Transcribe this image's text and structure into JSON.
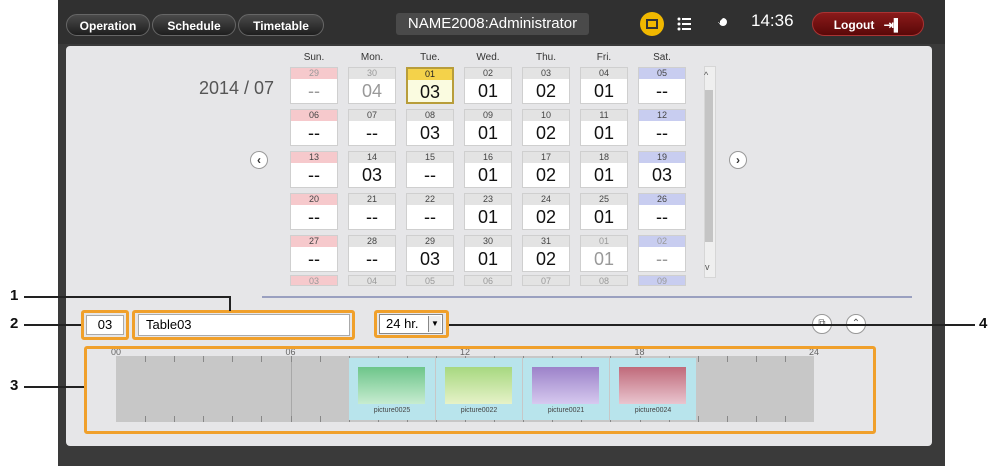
{
  "topbar": {
    "tabs": [
      {
        "label": "Operation"
      },
      {
        "label": "Schedule"
      },
      {
        "label": "Timetable"
      }
    ],
    "user": "NAME2008:Administrator",
    "time": "14:36",
    "logout_label": "Logout",
    "icons": [
      "schedule-folder-icon",
      "list-icon",
      "wrench-icon",
      "logout-icon"
    ],
    "colors": {
      "bar": "#303030",
      "logout": "#7a1212",
      "active_icon": "#f0b800"
    }
  },
  "calendar": {
    "year_month": "2014 / 07",
    "day_headers": [
      "Sun.",
      "Mon.",
      "Tue.",
      "Wed.",
      "Thu.",
      "Fri.",
      "Sat."
    ],
    "weeks": [
      [
        {
          "d": "29",
          "v": "--"
        },
        {
          "d": "30",
          "v": "04"
        },
        {
          "d": "01",
          "v": "03"
        },
        {
          "d": "02",
          "v": "01"
        },
        {
          "d": "03",
          "v": "02"
        },
        {
          "d": "04",
          "v": "01"
        },
        {
          "d": "05",
          "v": "--"
        }
      ],
      [
        {
          "d": "06",
          "v": "--"
        },
        {
          "d": "07",
          "v": "--"
        },
        {
          "d": "08",
          "v": "03"
        },
        {
          "d": "09",
          "v": "01"
        },
        {
          "d": "10",
          "v": "02"
        },
        {
          "d": "11",
          "v": "01"
        },
        {
          "d": "12",
          "v": "--"
        }
      ],
      [
        {
          "d": "13",
          "v": "--"
        },
        {
          "d": "14",
          "v": "03"
        },
        {
          "d": "15",
          "v": "--"
        },
        {
          "d": "16",
          "v": "01"
        },
        {
          "d": "17",
          "v": "02"
        },
        {
          "d": "18",
          "v": "01"
        },
        {
          "d": "19",
          "v": "03"
        }
      ],
      [
        {
          "d": "20",
          "v": "--"
        },
        {
          "d": "21",
          "v": "--"
        },
        {
          "d": "22",
          "v": "--"
        },
        {
          "d": "23",
          "v": "01"
        },
        {
          "d": "24",
          "v": "02"
        },
        {
          "d": "25",
          "v": "01"
        },
        {
          "d": "26",
          "v": "--"
        }
      ],
      [
        {
          "d": "27",
          "v": "--"
        },
        {
          "d": "28",
          "v": "--"
        },
        {
          "d": "29",
          "v": "03"
        },
        {
          "d": "30",
          "v": "01"
        },
        {
          "d": "31",
          "v": "02"
        },
        {
          "d": "01",
          "v": "01"
        },
        {
          "d": "02",
          "v": "--"
        }
      ],
      [
        {
          "d": "03",
          "v": ""
        },
        {
          "d": "04",
          "v": ""
        },
        {
          "d": "05",
          "v": ""
        },
        {
          "d": "06",
          "v": ""
        },
        {
          "d": "07",
          "v": ""
        },
        {
          "d": "08",
          "v": ""
        },
        {
          "d": "09",
          "v": ""
        }
      ]
    ],
    "selected_date": "01",
    "prev_label": "‹",
    "next_label": "›"
  },
  "editor": {
    "number": "03",
    "name": "Table03",
    "range_select": "24 hr."
  },
  "timeline": {
    "hour_labels": [
      "00",
      "06",
      "12",
      "18",
      "24"
    ],
    "blocks": [
      {
        "label": "picture0025",
        "color_top": "#6dc58a",
        "color_bottom": "#c7ecd0"
      },
      {
        "label": "picture0022",
        "color_top": "#a7d880",
        "color_bottom": "#e6f2c8"
      },
      {
        "label": "picture0021",
        "color_top": "#9c82c9",
        "color_bottom": "#d6c9ef"
      },
      {
        "label": "picture0024",
        "color_top": "#c06a7a",
        "color_bottom": "#e9c5cf"
      }
    ]
  },
  "callouts": [
    "1",
    "2",
    "3",
    "4"
  ],
  "colors": {
    "highlight": "#f0a02b",
    "panel": "#e6e6e8",
    "sunday": "#f6c9cc",
    "saturday": "#c8cdf0",
    "selected": "#f4d24a"
  }
}
